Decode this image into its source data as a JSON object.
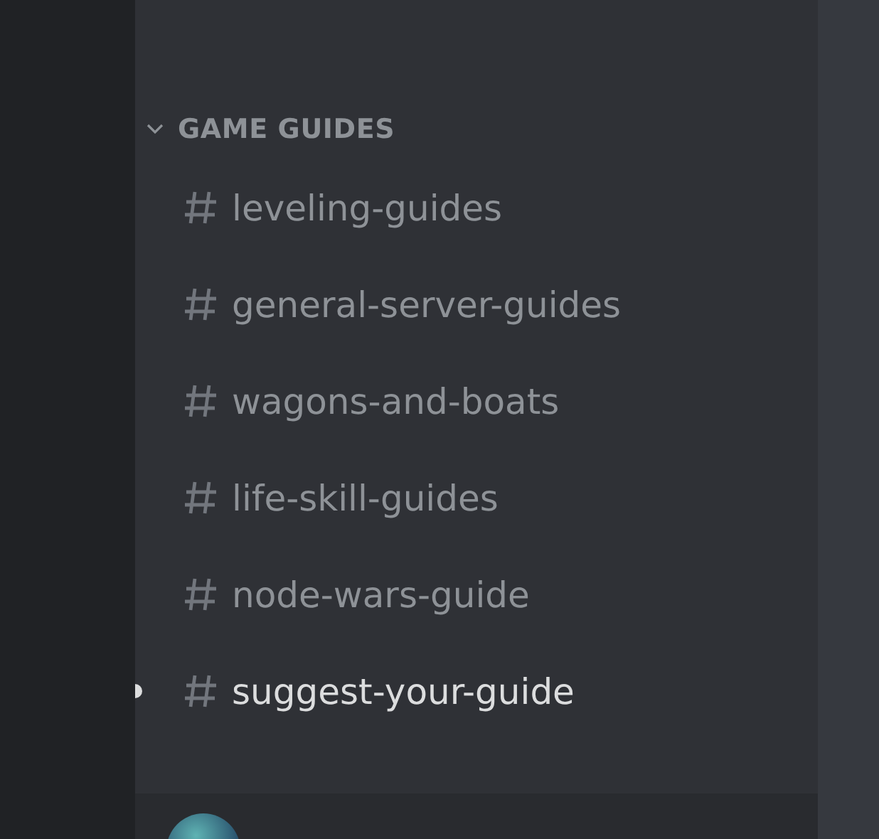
{
  "category": {
    "name": "GAME GUIDES",
    "expanded": true
  },
  "channels": [
    {
      "name": "leveling-guides",
      "unread": false
    },
    {
      "name": "general-server-guides",
      "unread": false
    },
    {
      "name": "wagons-and-boats",
      "unread": false
    },
    {
      "name": "life-skill-guides",
      "unread": false
    },
    {
      "name": "node-wars-guide",
      "unread": false
    },
    {
      "name": "suggest-your-guide",
      "unread": true
    }
  ]
}
